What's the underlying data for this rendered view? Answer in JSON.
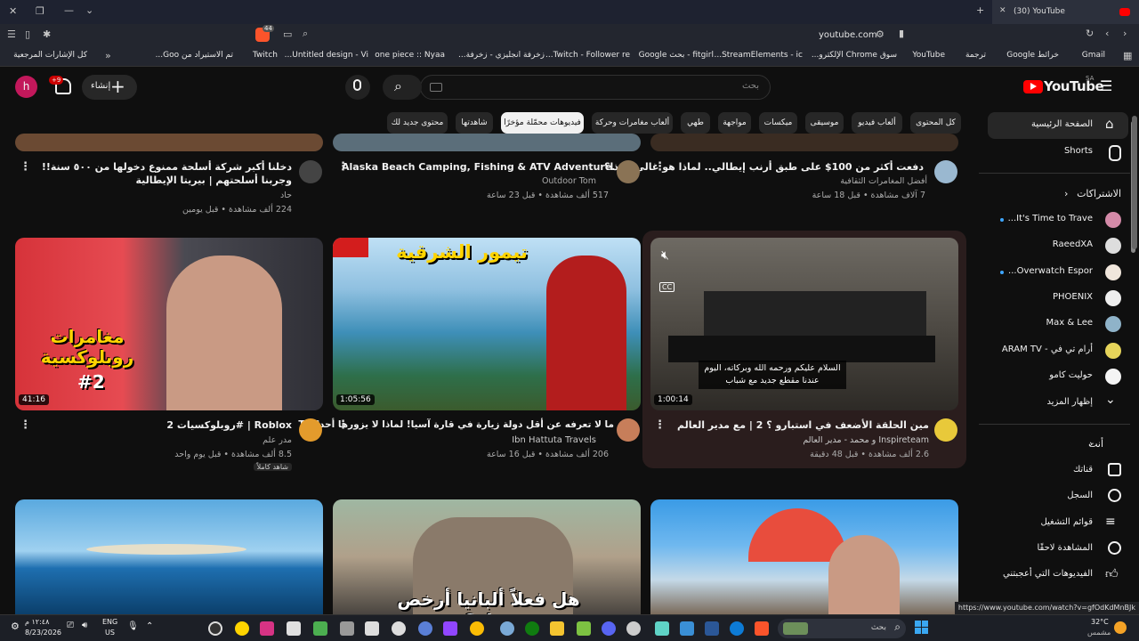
{
  "browser": {
    "tab_title": "(30) YouTube",
    "address": "youtube.com",
    "badge": "44",
    "status_url": "https://www.youtube.com/watch?v=gfOdKdMnBJk",
    "bookmarks": [
      "Gmail",
      "خرائط Google",
      "ترجمة",
      "YouTube",
      "سوق Chrome الإلكترو...",
      "StreamElements - ic...",
      "fitgirl - بحث Google",
      "Twitch - Follower re...",
      "زخرفة انجليزي - زخرفة...",
      "one piece :: Nyaa",
      "Untitled design - Vi...",
      "Twitch",
      "تم الاستيراد من Goo...",
      "كل الإشارات المرجعية"
    ]
  },
  "header": {
    "logo": "YouTube",
    "region": "SA",
    "search_placeholder": "بحث",
    "create_label": "إنشاء",
    "notif_count": "+9",
    "user_initial": "h"
  },
  "chips": [
    "كل المحتوى",
    "ألعاب فيديو",
    "موسيقى",
    "ميكسات",
    "مواجهة",
    "طهي",
    "ألعاب مغامرات وحركة",
    "فيديوهات محمّلة مؤخرًا",
    "شاهدتها",
    "محتوى جديد لك"
  ],
  "active_chip": "فيديوهات محمّلة مؤخرًا",
  "sidebar": {
    "home": "الصفحة الرئيسية",
    "shorts": "Shorts",
    "subs_header": "الاشتراكات",
    "subs": [
      "It's Time to Trave...",
      "RaeedXA",
      "Overwatch Espor...",
      "PHOENIX",
      "Max & Lee",
      "أرام تي في - ARAM TV",
      "حوليت كامو",
      "إظهار المزيد"
    ],
    "you_header": "أنت",
    "you": [
      "قناتك",
      "السجل",
      "قوائم التشغيل",
      "المشاهدة لاحقًا",
      "الفيديوهات التي أعجبتني"
    ]
  },
  "row1": [
    {
      "title": "دفعت أكثر من 100$ على طبق أرنب إيطالي.. لماذا هو غالي هكذا؟",
      "channel": "أفضل المغامرات الثقافية",
      "meta": "7 آلاف مشاهدة • قبل 18 ساعة"
    },
    {
      "title": "Alaska Beach Camping, Fishing & ATV Adventure.",
      "channel": "Outdoor Tom",
      "meta": "517 ألف مشاهدة • قبل 23 ساعة"
    },
    {
      "title": "دخلنا أكبر شركة أسلحة ممنوع دخولها من ٥٠٠ سنة!! وجربنا أسلحتهم | بيريتا الإيطالية",
      "channel": "حاد",
      "meta": "224 ألف مشاهدة • قبل يومين"
    }
  ],
  "row2": [
    {
      "title": "مين الحلقة الأضعف في استبارو ؟ 2 | مع مدير العالم",
      "channel": "Inspireteam و محمد - مدير العالم",
      "meta": "2.6 ألف مشاهدة • قبل 48 دقيقة",
      "duration": "1:00:14",
      "caption": "السلام عليكم ورحمه الله وبركاته، اليوم عندنا مقطع جديد مع شباب",
      "cc": "CC"
    },
    {
      "title": "ما لا تعرفه عن أقل دولة زيارة في قارة آسيا! لماذا لا يزورها أحد؟ TL",
      "channel": "Ibn Hattuta Travels",
      "meta": "206 ألف مشاهدة • قبل 16 ساعة",
      "duration": "1:05:56",
      "overlay": "تيمور الشرقية"
    },
    {
      "title": "روبلوكسيات 2# | Roblox",
      "channel": "مدر علم",
      "meta": "8.5 ألف مشاهدة • قبل يوم واحد",
      "duration": "41:16",
      "overlay": "مغامرات روبلوكسية",
      "tag": "#2",
      "badge": "شاهد كاملاً"
    }
  ],
  "row3": [
    {
      "overlay": ""
    },
    {
      "overlay": "هل فعلاً ألبانيا أرخص دولة؟"
    },
    {
      "overlay": ""
    }
  ],
  "taskbar": {
    "weather": "32°C",
    "weather_desc": "مشمس",
    "search": "بحث",
    "lang": "ENG",
    "lang2": "US",
    "time": "١٢:٤٨ م",
    "date": "8/23/2026"
  },
  "colors": {
    "brand": "#ff0000",
    "accent": "#3ea6ff"
  }
}
